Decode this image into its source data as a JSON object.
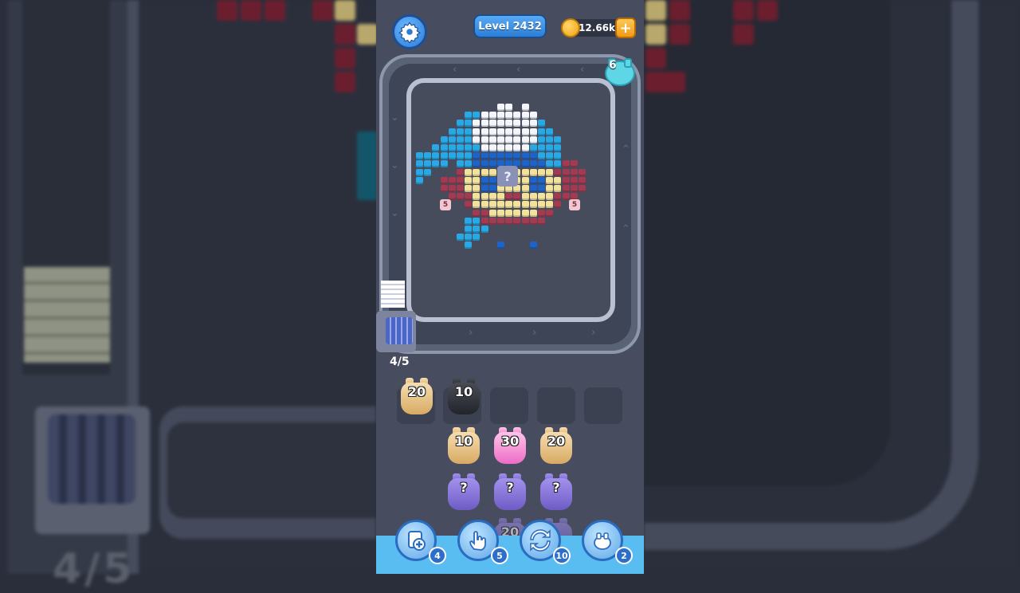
{
  "header": {
    "level_label": "Level 2432",
    "coins": "12.66k",
    "plus_label": "+"
  },
  "board": {
    "capacity_count": "6",
    "mystery_label": "?",
    "ear_badge_left": "5",
    "ear_badge_right": "5"
  },
  "slots": {
    "counter": "4/5",
    "filled": [
      {
        "color": "tan",
        "value": "20"
      },
      {
        "color": "black",
        "value": "10"
      }
    ],
    "empty_count": 3
  },
  "queue": {
    "columns": [
      [
        {
          "color": "tan",
          "value": "10"
        },
        {
          "color": "mystery",
          "value": "?"
        }
      ],
      [
        {
          "color": "pink",
          "value": "30"
        },
        {
          "color": "mystery",
          "value": "?"
        },
        {
          "color": "mystery-faded",
          "value": "20"
        }
      ],
      [
        {
          "color": "tan",
          "value": "20"
        },
        {
          "color": "mystery",
          "value": "?"
        }
      ]
    ]
  },
  "powerups": [
    {
      "name": "add-slot",
      "icon": "card-plus-icon",
      "count": "4"
    },
    {
      "name": "hand",
      "icon": "hand-tap-icon",
      "count": "5"
    },
    {
      "name": "shuffle",
      "icon": "shuffle-icon",
      "count": "10"
    },
    {
      "name": "magnet",
      "icon": "pig-swap-icon",
      "count": "2"
    }
  ],
  "background": {
    "fraction": "4/5"
  },
  "colors": {
    "accent_blue": "#2c7ed6",
    "coin_gold": "#f0a312",
    "bar_blue": "#59bdf2"
  }
}
